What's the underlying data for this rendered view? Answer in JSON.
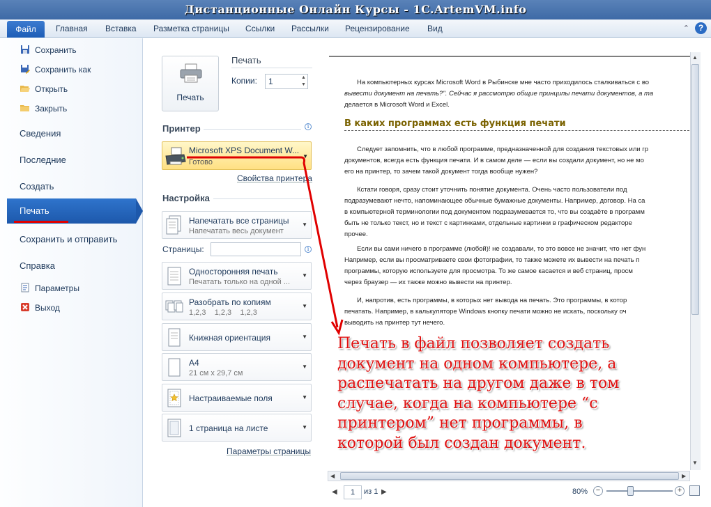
{
  "window": {
    "title": "Дистанционные Онлайн Курсы - 1C.ArtemVM.info"
  },
  "ribbon": {
    "file_tab": "Файл",
    "tabs": [
      "Главная",
      "Вставка",
      "Разметка страницы",
      "Ссылки",
      "Рассылки",
      "Рецензирование",
      "Вид"
    ],
    "help_icon": "question-icon",
    "help_glyph": "?"
  },
  "backstage_nav": {
    "small_items": [
      {
        "label": "Сохранить",
        "icon": "save-icon"
      },
      {
        "label": "Сохранить как",
        "icon": "save-as-icon"
      },
      {
        "label": "Открыть",
        "icon": "open-folder-icon"
      },
      {
        "label": "Закрыть",
        "icon": "close-folder-icon"
      }
    ],
    "big_items": [
      "Сведения",
      "Последние",
      "Создать",
      "Печать",
      "Сохранить и отправить",
      "Справка"
    ],
    "selected": "Печать",
    "bottom_items": [
      {
        "label": "Параметры",
        "icon": "options-icon"
      },
      {
        "label": "Выход",
        "icon": "exit-icon"
      }
    ]
  },
  "print_panel": {
    "print_button_label": "Печать",
    "section_title": "Печать",
    "copies_label": "Копии:",
    "copies_value": "1",
    "printer_header": "Принтер",
    "printer_name": "Microsoft XPS Document W...",
    "printer_status": "Готово",
    "printer_properties_link": "Свойства принтера",
    "settings_header": "Настройка",
    "pages_label": "Страницы:",
    "pages_value": "",
    "dropdowns": [
      {
        "main": "Напечатать все страницы",
        "sub": "Напечатать весь документ",
        "icon": "pages-icon"
      },
      {
        "main": "Односторонняя печать",
        "sub": "Печатать только на одной ...",
        "icon": "one-sided-icon"
      },
      {
        "main": "Разобрать по копиям",
        "sub": "1,2,3    1,2,3    1,2,3",
        "icon": "collate-icon"
      },
      {
        "main": "Книжная ориентация",
        "sub": "",
        "icon": "portrait-icon"
      },
      {
        "main": "А4",
        "sub": "21 см х 29,7 см",
        "icon": "paper-size-icon"
      },
      {
        "main": "Настраиваемые поля",
        "sub": "",
        "icon": "margins-icon"
      },
      {
        "main": "1 страница на листе",
        "sub": "",
        "icon": "pages-per-sheet-icon"
      }
    ],
    "page_setup_link": "Параметры страницы"
  },
  "preview": {
    "paragraphs": [
      [
        "На компьютерных курсах Microsoft Word в Рыбинске мне часто приходилось сталкиваться с во",
        "вывести документ на печать?\". Сейчас я рассмотрю общие принципы печати документов, а та",
        "делается в Microsoft Word и Excel."
      ],
      [
        "Следует запомнить, что в любой программе, предназначенной для создания текстовых или гр",
        "документов, всегда есть функция печати. И в самом деле — если вы создали документ, но не мо",
        "его на принтер, то зачем такой документ тогда вообще нужен?"
      ],
      [
        "Кстати говоря, сразу стоит уточнить понятие документа. Очень часто пользователи под",
        "подразумевают нечто, напоминающее обычные бумажные документы. Например, договор. На са",
        "в компьютерной терминологии под документом подразумевается то, что вы создаёте в программ",
        "быть не только текст, но и текст с картинками, отдельные картинки в графическом редакторе",
        "прочее."
      ],
      [
        "Если вы сами ничего в программе (любой)! не создавали, то это вовсе не значит, что нет фун",
        "Например, если вы просматриваете свои фотографии, то также можете их вывести на печать п",
        "программы, которую используете для просмотра. То же самое касается и веб страниц, просм",
        "через браузер — их также можно вывести на принтер."
      ],
      [
        "И, напротив, есть программы, в которых нет вывода на печать. Это программы, в котор",
        "печатать. Например, в калькуляторе Windows кнопку печати можно не искать, поскольку оч",
        "выводить на принтер тут нечего."
      ]
    ],
    "heading": "В каких программах есть функция печати",
    "page_current": "1",
    "page_total_label": "из 1",
    "zoom": "80%"
  },
  "annotation": {
    "lines": [
      "Печать в файл позволяет создать",
      "документ на одном компьютере, а",
      "распечатать на другом даже в том",
      "случае, когда на компьютере “с",
      "принтером” нет программы, в",
      "которой был создан документ."
    ]
  },
  "colors": {
    "accent": "#1d5db6",
    "annotation": "#e01010"
  }
}
